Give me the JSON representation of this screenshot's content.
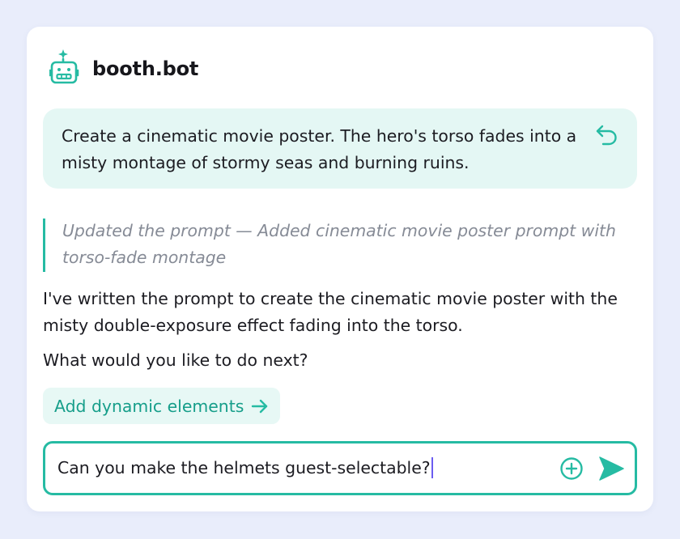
{
  "app": {
    "brand": "booth.bot",
    "logo_icon": "robot-icon"
  },
  "colors": {
    "accent": "#26bba3",
    "accent_text": "#169e8a",
    "bubble_bg": "#e4f7f4",
    "page_bg": "#e9edfb",
    "status_text": "#868b96"
  },
  "conversation": {
    "user_message": "Create a cinematic movie poster. The hero's torso fades into a misty montage of stormy seas and burning ruins.",
    "undo_icon": "undo-icon",
    "status_note": "Updated the prompt — Added cinematic movie poster prompt with torso-fade montage",
    "assistant_reply": "I've written the prompt to create the cinematic movie poster with the misty double-exposure effect fading into the torso.",
    "assistant_question": "What would you like to do next?"
  },
  "suggestions": [
    {
      "label": "Add dynamic elements",
      "icon": "arrow-right-icon"
    }
  ],
  "composer": {
    "value": "Can you make the helmets guest-selectable?",
    "add_icon": "plus-circle-icon",
    "send_icon": "send-icon"
  }
}
